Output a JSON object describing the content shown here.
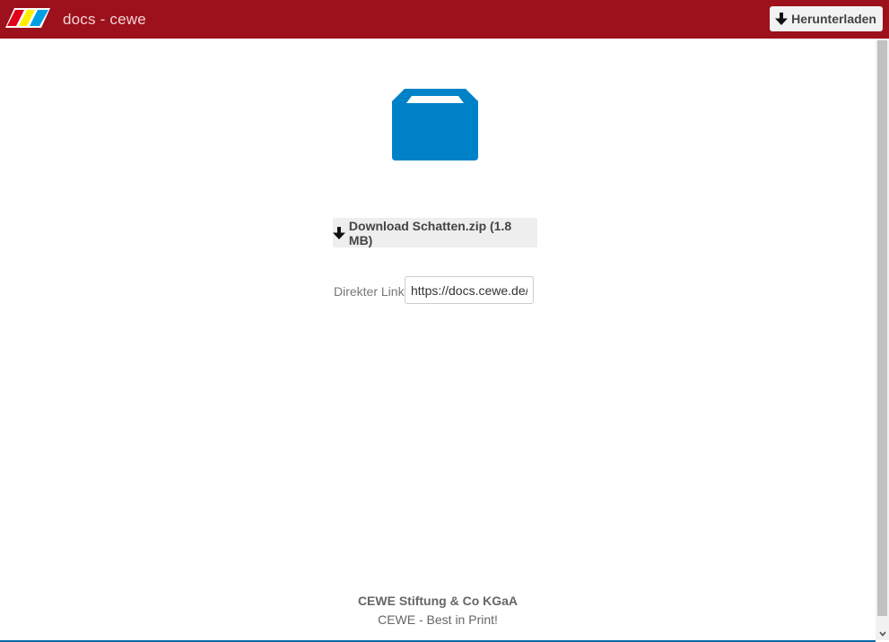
{
  "header": {
    "title": "docs - cewe",
    "download_label": "Herunterladen",
    "background_color": "#9c111b",
    "logo_colors": [
      "#e2001a",
      "#ffed00",
      "#009fe3"
    ]
  },
  "main": {
    "folder_icon": "folder-icon",
    "folder_color": "#0082c8",
    "download_button_label": "Download Schatten.zip (1.8 MB)",
    "direct_link_label": "Direkter Link",
    "direct_link_value": "https://docs.cewe.de/"
  },
  "footer": {
    "company": "CEWE Stiftung & Co KGaA",
    "slogan": "CEWE - Best in Print!"
  }
}
